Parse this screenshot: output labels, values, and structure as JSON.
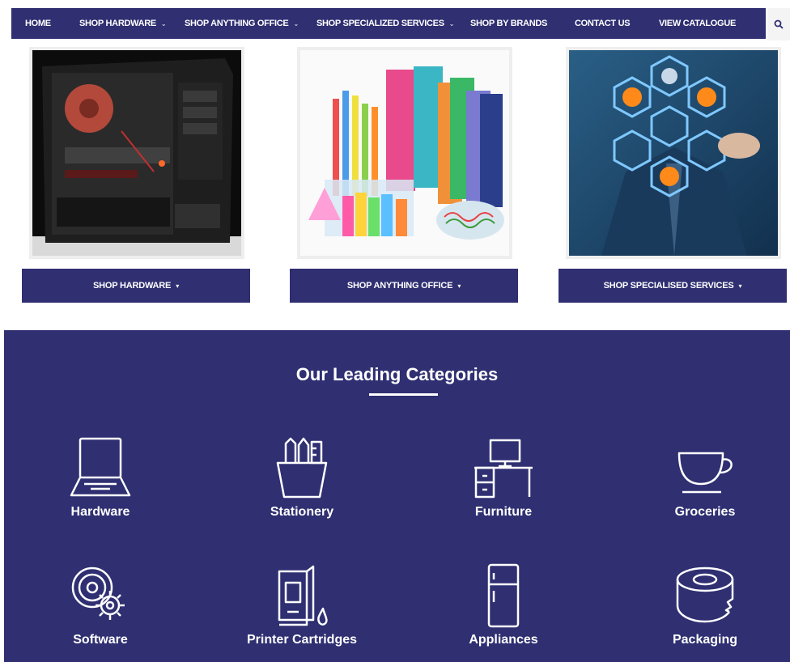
{
  "nav": {
    "items": [
      {
        "label": "HOME",
        "caret": false
      },
      {
        "label": "SHOP HARDWARE",
        "caret": true
      },
      {
        "label": "SHOP ANYTHING OFFICE",
        "caret": true
      },
      {
        "label": "SHOP SPECIALIZED SERVICES",
        "caret": true
      },
      {
        "label": "SHOP BY BRANDS",
        "caret": false
      },
      {
        "label": "CONTACT US",
        "caret": false
      },
      {
        "label": "VIEW CATALOGUE",
        "caret": false
      }
    ],
    "search_icon": "search-icon"
  },
  "cards": [
    {
      "button": "SHOP HARDWARE",
      "image": "computer-case-image"
    },
    {
      "button": "SHOP ANYTHING OFFICE",
      "image": "stationery-image"
    },
    {
      "button": "SHOP SPECIALISED SERVICES",
      "image": "services-image"
    }
  ],
  "categories": {
    "title": "Our Leading Categories",
    "items": [
      {
        "label": "Hardware",
        "icon": "laptop-icon"
      },
      {
        "label": "Stationery",
        "icon": "pencil-cup-icon"
      },
      {
        "label": "Furniture",
        "icon": "desk-icon"
      },
      {
        "label": "Groceries",
        "icon": "cup-icon"
      },
      {
        "label": "Software",
        "icon": "disc-gear-icon"
      },
      {
        "label": "Printer Cartridges",
        "icon": "cartridge-icon"
      },
      {
        "label": "Appliances",
        "icon": "fridge-icon"
      },
      {
        "label": "Packaging",
        "icon": "tape-icon"
      }
    ]
  },
  "colors": {
    "primary": "#2f2f72",
    "white": "#ffffff"
  }
}
